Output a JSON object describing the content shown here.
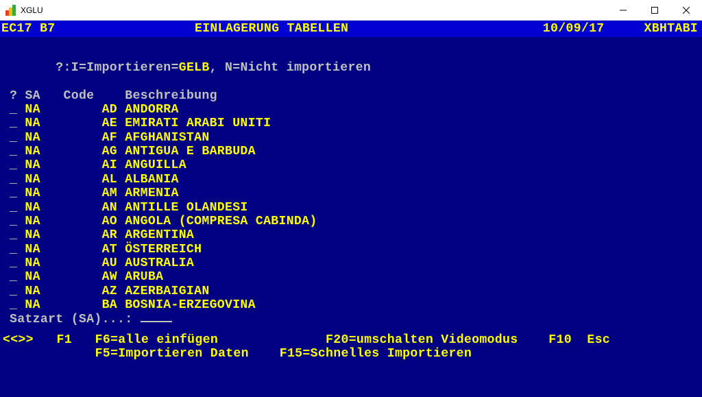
{
  "window": {
    "title": "XGLU"
  },
  "header": {
    "left": "EC17 B7",
    "title": "EINLAGERUNG TABELLEN",
    "date": "10/09/17",
    "right": "XBHTABI"
  },
  "legend": {
    "prefix": "?:I=Importieren=",
    "highlight": "GELB",
    "suffix": ", N=Nicht importieren"
  },
  "columns": {
    "q": "?",
    "sa": "SA",
    "code": "Code",
    "desc": "Beschreibung"
  },
  "rows": [
    {
      "sa": "NA",
      "code": "AD",
      "desc": "ANDORRA"
    },
    {
      "sa": "NA",
      "code": "AE",
      "desc": "EMIRATI ARABI UNITI"
    },
    {
      "sa": "NA",
      "code": "AF",
      "desc": "AFGHANISTAN"
    },
    {
      "sa": "NA",
      "code": "AG",
      "desc": "ANTIGUA E BARBUDA"
    },
    {
      "sa": "NA",
      "code": "AI",
      "desc": "ANGUILLA"
    },
    {
      "sa": "NA",
      "code": "AL",
      "desc": "ALBANIA"
    },
    {
      "sa": "NA",
      "code": "AM",
      "desc": "ARMENIA"
    },
    {
      "sa": "NA",
      "code": "AN",
      "desc": "ANTILLE OLANDESI"
    },
    {
      "sa": "NA",
      "code": "AO",
      "desc": "ANGOLA (COMPRESA CABINDA)"
    },
    {
      "sa": "NA",
      "code": "AR",
      "desc": "ARGENTINA"
    },
    {
      "sa": "NA",
      "code": "AT",
      "desc": "ÖSTERREICH"
    },
    {
      "sa": "NA",
      "code": "AU",
      "desc": "AUSTRALIA"
    },
    {
      "sa": "NA",
      "code": "AW",
      "desc": "ARUBA"
    },
    {
      "sa": "NA",
      "code": "AZ",
      "desc": "AZERBAIGIAN"
    },
    {
      "sa": "NA",
      "code": "BA",
      "desc": "BOSNIA-ERZEGOVINA"
    }
  ],
  "satzart_label": "Satzart (SA)...: ",
  "fkeys": {
    "nav": "<<>>",
    "f1": "F1",
    "f6": "F6=alle einfügen",
    "f20": "F20=umschalten Videomodus",
    "f10": "F10",
    "esc": "Esc",
    "f5": "F5=Importieren Daten",
    "f15": "F15=Schnelles Importieren"
  }
}
